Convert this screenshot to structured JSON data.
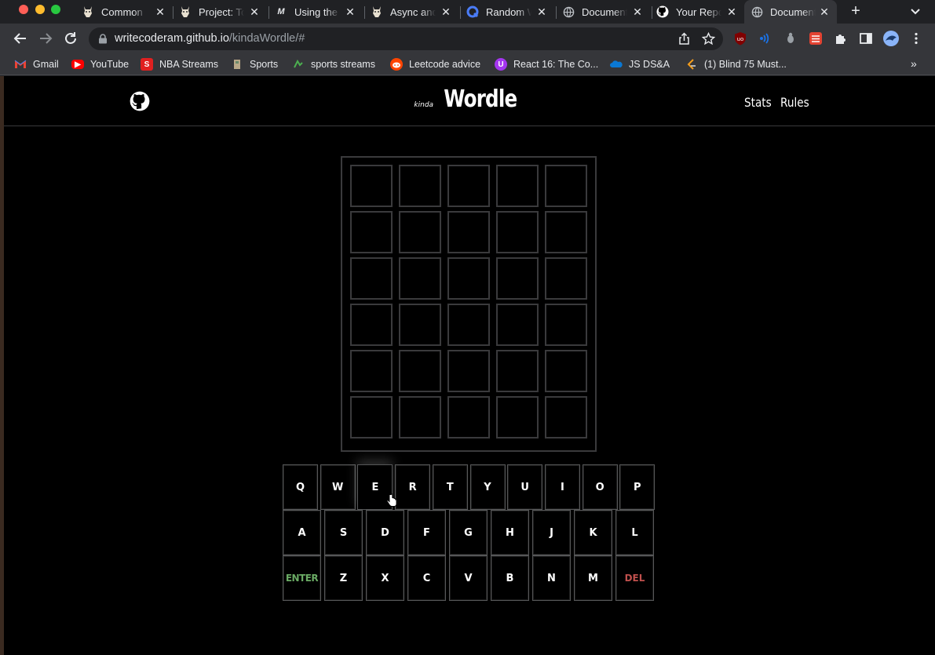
{
  "browser": {
    "tabs": [
      {
        "title": "Common",
        "icon": "odin-icon"
      },
      {
        "title": "Project: To",
        "icon": "odin-icon"
      },
      {
        "title": "Using the",
        "icon": "medium-icon"
      },
      {
        "title": "Async and",
        "icon": "odin-icon"
      },
      {
        "title": "Random W",
        "icon": "quickref-icon"
      },
      {
        "title": "Document",
        "icon": "globe-icon"
      },
      {
        "title": "Your Repo",
        "icon": "github-icon"
      },
      {
        "title": "Document",
        "icon": "globe-icon",
        "active": true
      }
    ],
    "url_host": "writecoderam.github.io",
    "url_path": "/kindaWordle/#",
    "bookmarks": [
      {
        "label": "Gmail",
        "icon": "gmail-icon",
        "color": "#ea4335"
      },
      {
        "label": "YouTube",
        "icon": "youtube-icon",
        "color": "#ff0000"
      },
      {
        "label": "NBA Streams",
        "icon": "streams-icon",
        "color": "#e02020"
      },
      {
        "label": "Sports",
        "icon": "sports-icon",
        "color": "#8a7a60"
      },
      {
        "label": "sports streams",
        "icon": "sports-streams-icon",
        "color": "#3a8a3a"
      },
      {
        "label": "Leetcode advice",
        "icon": "reddit-icon",
        "color": "#ff4500"
      },
      {
        "label": "React 16: The Co...",
        "icon": "udemy-icon",
        "color": "#a435f0"
      },
      {
        "label": "JS DS&A",
        "icon": "onedrive-icon",
        "color": "#0a78d4"
      },
      {
        "label": "(1) Blind 75 Must...",
        "icon": "leetcode-icon",
        "color": "#f89f1b"
      }
    ],
    "more_bookmarks": "»"
  },
  "site": {
    "brand_prefix": "kinda",
    "brand_name": "Wordle",
    "nav": {
      "stats": "Stats",
      "rules": "Rules"
    }
  },
  "board": {
    "rows": 6,
    "cols": 5
  },
  "keyboard": {
    "row1": [
      "Q",
      "W",
      "E",
      "R",
      "T",
      "Y",
      "U",
      "I",
      "O",
      "P"
    ],
    "row2": [
      "A",
      "S",
      "D",
      "F",
      "G",
      "H",
      "J",
      "K",
      "L"
    ],
    "row3": [
      "ENTER",
      "Z",
      "X",
      "C",
      "V",
      "B",
      "N",
      "M",
      "DEL"
    ],
    "hovered_key": "E"
  },
  "colors": {
    "background": "#000000",
    "tile_border": "#3a3a3c",
    "enter": "#6aaa64",
    "del": "#c0504d"
  }
}
